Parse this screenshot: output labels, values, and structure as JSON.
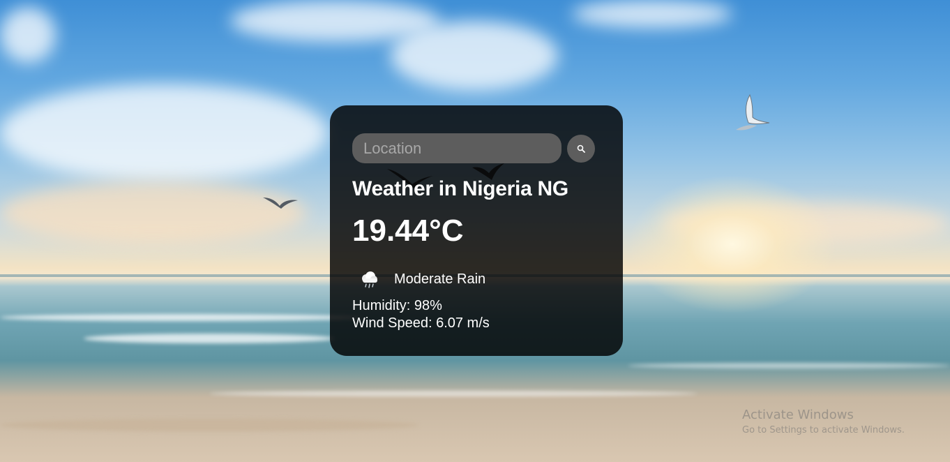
{
  "search": {
    "placeholder": "Location",
    "icon": "search-icon"
  },
  "weather": {
    "title": "Weather in Nigeria NG",
    "temperature": "19.44°C",
    "icon": "rain-cloud-icon",
    "description": "Moderate Rain",
    "humidity": "Humidity: 98%",
    "wind": "Wind Speed: 6.07 m/s"
  },
  "background": {
    "scene": "beach-sunset"
  },
  "system_watermark": {
    "line1": "Activate Windows",
    "line2": "Go to Settings to activate Windows."
  }
}
